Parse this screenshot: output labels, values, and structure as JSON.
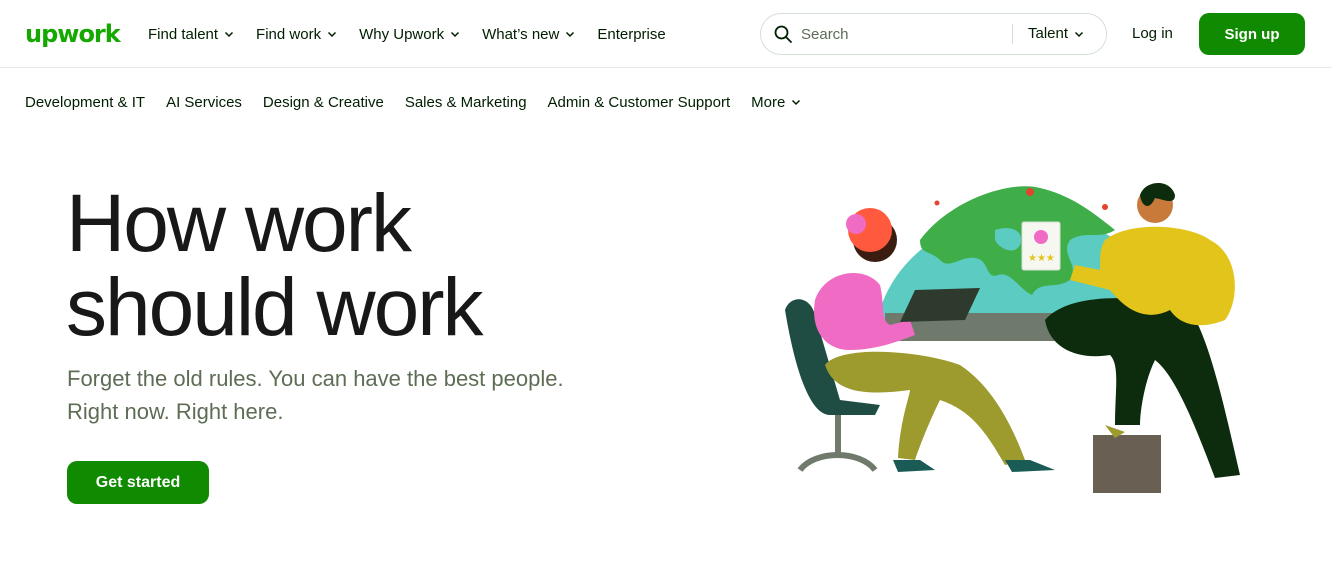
{
  "brand": {
    "logo_text": "upwork",
    "color": "#14a800"
  },
  "main_nav": {
    "items": [
      {
        "label": "Find talent",
        "has_dropdown": true
      },
      {
        "label": "Find work",
        "has_dropdown": true
      },
      {
        "label": "Why Upwork",
        "has_dropdown": true
      },
      {
        "label": "What’s new",
        "has_dropdown": true
      },
      {
        "label": "Enterprise",
        "has_dropdown": false
      }
    ]
  },
  "search": {
    "placeholder": "Search",
    "value": "",
    "scope": "Talent",
    "icon": "search-icon"
  },
  "auth": {
    "login_label": "Log in",
    "signup_label": "Sign up",
    "signup_color": "#108a00"
  },
  "category_nav": {
    "items": [
      {
        "label": "Development & IT"
      },
      {
        "label": "AI Services"
      },
      {
        "label": "Design & Creative"
      },
      {
        "label": "Sales & Marketing"
      },
      {
        "label": "Admin & Customer Support"
      },
      {
        "label": "More",
        "has_dropdown": true
      }
    ]
  },
  "hero": {
    "title_line1": "How work",
    "title_line2": "should work",
    "subtitle_line1": "Forget the old rules. You can have the best people.",
    "subtitle_line2": "Right now. Right here.",
    "cta_label": "Get started",
    "cta_color": "#108a00"
  }
}
